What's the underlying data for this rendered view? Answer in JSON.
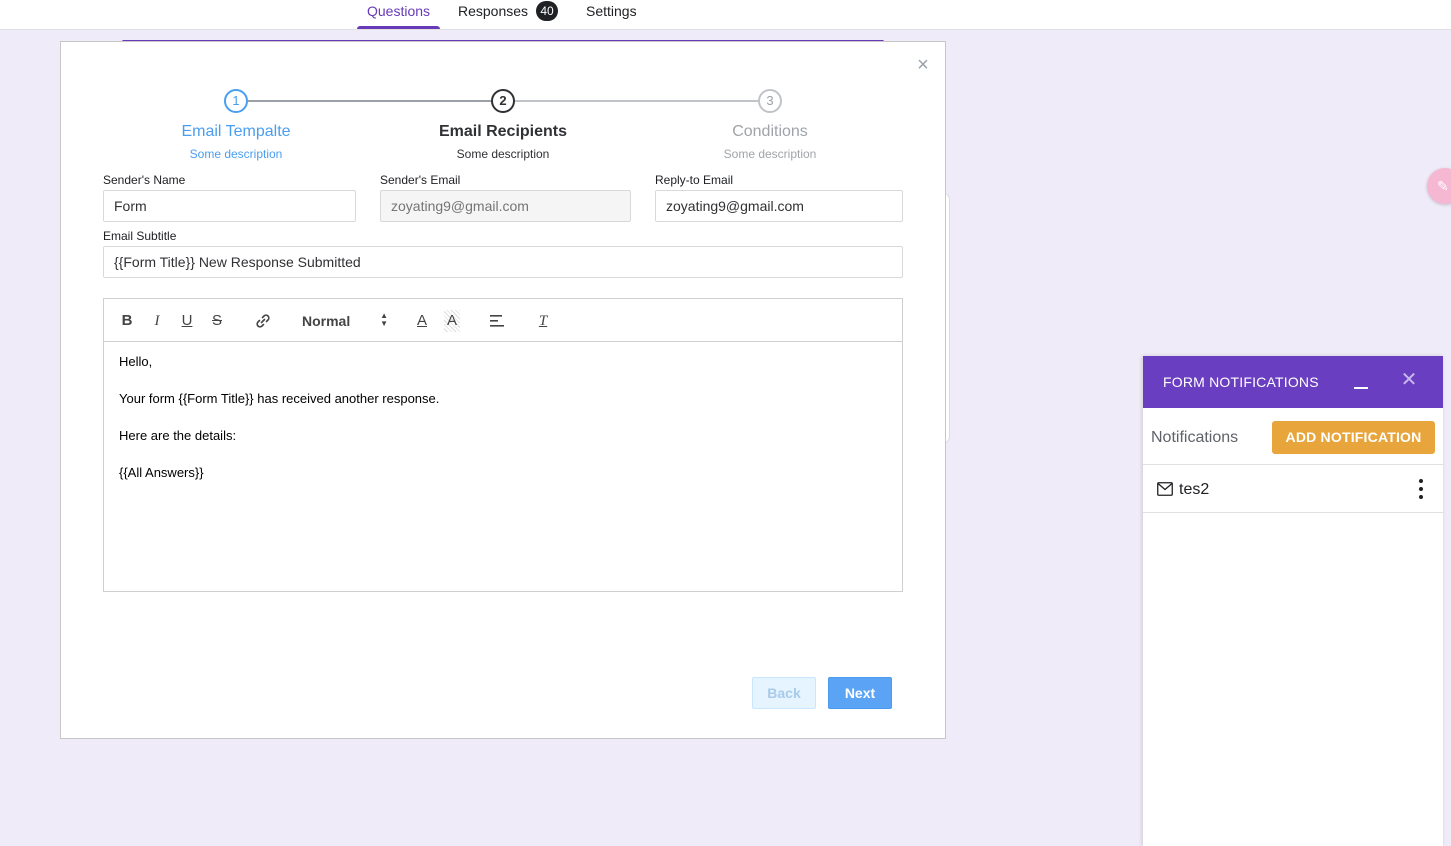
{
  "tabs": {
    "questions": "Questions",
    "responses": "Responses",
    "responses_count": "40",
    "settings": "Settings"
  },
  "modal": {
    "close": "×",
    "steps": [
      {
        "number": "1",
        "title": "Email Tempalte",
        "description": "Some description",
        "state": "current"
      },
      {
        "number": "2",
        "title": "Email Recipients",
        "description": "Some description",
        "state": "active"
      },
      {
        "number": "3",
        "title": "Conditions",
        "description": "Some description",
        "state": "pending"
      }
    ],
    "fields": {
      "sender_name": {
        "label": "Sender's Name",
        "value": "Form"
      },
      "sender_email": {
        "label": "Sender's Email",
        "placeholder": "zoyating9@gmail.com"
      },
      "reply_to": {
        "label": "Reply-to Email",
        "value": "zoyating9@gmail.com"
      },
      "subtitle": {
        "label": "Email Subtitle",
        "value": "{{Form Title}} New Response Submitted"
      }
    },
    "editor": {
      "toolbar": {
        "bold": "B",
        "italic": "I",
        "underline": "U",
        "strike": "S",
        "size": "Normal",
        "color": "A",
        "background": "A",
        "clear": "T"
      },
      "body": [
        "Hello,",
        "Your form {{Form Title}} has received another response.",
        "Here are the details:",
        "{{All Answers}}"
      ]
    },
    "buttons": {
      "back": "Back",
      "next": "Next"
    }
  },
  "notifications_panel": {
    "title": "FORM NOTIFICATIONS",
    "subheader": "Notifications",
    "add_button": "ADD NOTIFICATION",
    "items": [
      {
        "label": "tes2",
        "icon": "mail-icon"
      }
    ]
  },
  "colors": {
    "brand_purple": "#673ab7",
    "panel_header": "#6a3ec0",
    "accent_orange": "#e8a53b",
    "step_blue": "#4a9eef",
    "next_blue": "#5ba4f5"
  }
}
